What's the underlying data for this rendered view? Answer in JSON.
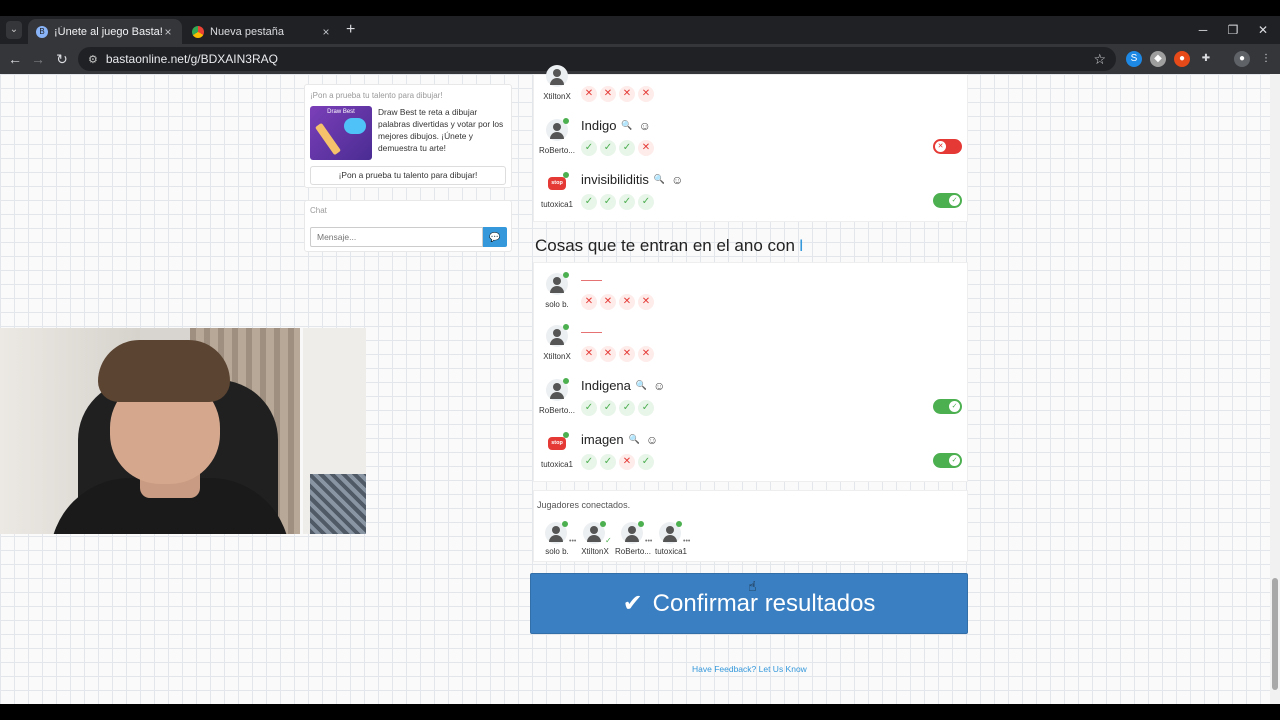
{
  "browser": {
    "tabs": [
      {
        "title": "¡Únete al juego Basta!"
      },
      {
        "title": "Nueva pestaña"
      }
    ],
    "url": "bastaonline.net/g/BDXAIN3RAQ"
  },
  "promo": {
    "title": "¡Pon a prueba tu talento para dibujar!",
    "image_caption": "Draw Best",
    "text": "Draw Best te reta a dibujar palabras divertidas y votar por los mejores dibujos. ¡Únete y demuestra tu arte!",
    "button": "¡Pon a prueba tu talento para dibujar!"
  },
  "chat": {
    "title": "Chat",
    "placeholder": "Mensaje..."
  },
  "previous_category": {
    "rows": [
      {
        "player": "XtiltonX",
        "avatar": "user",
        "answer": "",
        "votes": [
          "x",
          "x",
          "x",
          "x"
        ],
        "toggle": null
      },
      {
        "player": "RoBerto...",
        "avatar": "user",
        "answer": "Indigo",
        "votes": [
          "ok",
          "ok",
          "ok",
          "x"
        ],
        "toggle": "off"
      },
      {
        "player": "tutoxica1",
        "avatar": "stop",
        "answer": "invisibiliditis",
        "votes": [
          "ok",
          "ok",
          "ok",
          "ok"
        ],
        "toggle": "on"
      }
    ]
  },
  "category": {
    "title": "Cosas que te entran en el ano con",
    "letter": "I",
    "rows": [
      {
        "player": "solo b.",
        "avatar": "user",
        "answer": "",
        "votes": [
          "x",
          "x",
          "x",
          "x"
        ],
        "toggle": null
      },
      {
        "player": "XtiltonX",
        "avatar": "user",
        "answer": "",
        "votes": [
          "x",
          "x",
          "x",
          "x"
        ],
        "toggle": null
      },
      {
        "player": "RoBerto...",
        "avatar": "user",
        "answer": "Indigena",
        "votes": [
          "ok",
          "ok",
          "ok",
          "ok"
        ],
        "toggle": "on"
      },
      {
        "player": "tutoxica1",
        "avatar": "stop",
        "answer": "imagen",
        "votes": [
          "ok",
          "ok",
          "x",
          "ok"
        ],
        "toggle": "on"
      }
    ]
  },
  "players": {
    "title": "Jugadores conectados.",
    "list": [
      {
        "name": "solo b.",
        "status": "dots"
      },
      {
        "name": "XtiltonX",
        "status": "ready"
      },
      {
        "name": "RoBerto...",
        "status": "dots"
      },
      {
        "name": "tutoxica1",
        "status": "dots"
      }
    ]
  },
  "confirm_label": "Confirmar resultados",
  "feedback_label": "Have Feedback? Let Us Know",
  "stop_label": "stop"
}
